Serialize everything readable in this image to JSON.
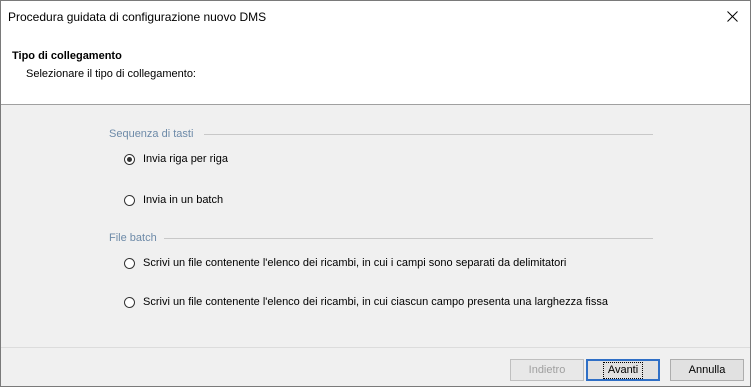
{
  "window": {
    "title": "Procedura guidata di configurazione nuovo DMS"
  },
  "header": {
    "title": "Tipo di collegamento",
    "subtitle": "Selezionare il tipo di collegamento:"
  },
  "groups": {
    "keystroke": {
      "label": "Sequenza di tasti",
      "options": [
        {
          "label": "Invia riga per riga",
          "checked": true
        },
        {
          "label": "Invia in un batch",
          "checked": false
        }
      ]
    },
    "batch_file": {
      "label": "File batch",
      "options": [
        {
          "label": "Scrivi un file contenente l'elenco dei ricambi, in cui i campi sono separati da delimitatori",
          "checked": false
        },
        {
          "label": "Scrivi un file contenente l'elenco dei ricambi, in cui ciascun campo presenta una larghezza fissa",
          "checked": false
        }
      ]
    }
  },
  "footer": {
    "back_label": "Indietro",
    "next_label": "Avanti",
    "cancel_label": "Annulla"
  },
  "colors": {
    "group_label": "#6d8aa8",
    "default_button_border": "#2f6fc6"
  },
  "icons": {
    "close": "close-icon"
  }
}
